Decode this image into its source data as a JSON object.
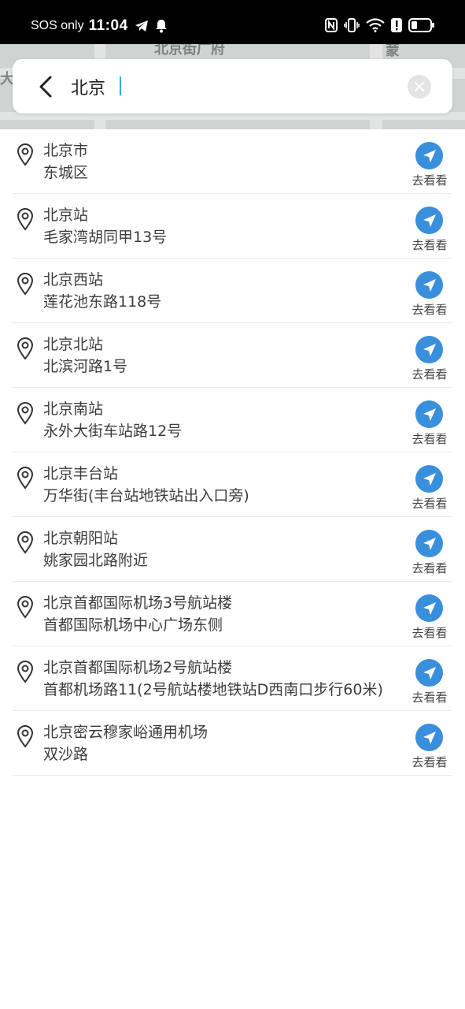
{
  "status_bar": {
    "carrier": "SOS only",
    "time": "11:04"
  },
  "search": {
    "value": "北京",
    "placeholder": ""
  },
  "go_label": "去看看",
  "results": [
    {
      "title": "北京市",
      "address": "东城区"
    },
    {
      "title": "北京站",
      "address": "毛家湾胡同甲13号"
    },
    {
      "title": "北京西站",
      "address": "莲花池东路118号"
    },
    {
      "title": "北京北站",
      "address": "北滨河路1号"
    },
    {
      "title": "北京南站",
      "address": "永外大街车站路12号"
    },
    {
      "title": "北京丰台站",
      "address": "万华街(丰台站地铁站出入口旁)"
    },
    {
      "title": "北京朝阳站",
      "address": "姚家园北路附近"
    },
    {
      "title": "北京首都国际机场3号航站楼",
      "address": "首都国际机场中心广场东侧"
    },
    {
      "title": "北京首都国际机场2号航站楼",
      "address": "首都机场路11(2号航站楼地铁站D西南口步行60米)"
    },
    {
      "title": "北京密云穆家峪通用机场",
      "address": "双沙路"
    }
  ],
  "colors": {
    "accent": "#3a8fdc",
    "caret": "#2fb3d6",
    "text": "#3c3c3c"
  }
}
